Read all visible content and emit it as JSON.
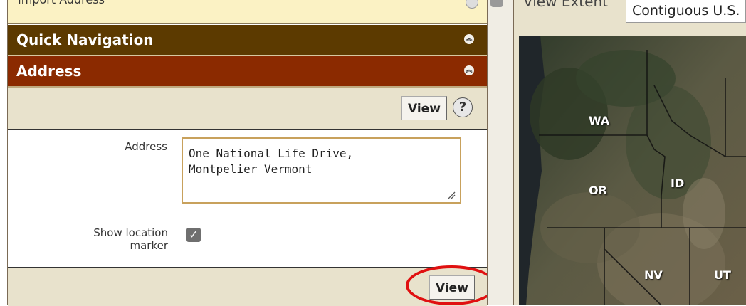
{
  "top_panel": {
    "label": "Import Address"
  },
  "quick_navigation": {
    "title": "Quick Navigation"
  },
  "address_section": {
    "title": "Address",
    "view_label": "View",
    "help_glyph": "?",
    "address_label": "Address",
    "address_value": "One National Life Drive,\nMontpelier Vermont",
    "show_marker_label_line1": "Show location",
    "show_marker_label_line2": "marker",
    "show_marker_checked": true,
    "bottom_view_label": "View"
  },
  "right_pane": {
    "extent_label": "View Extent",
    "extent_value": "Contiguous U.S."
  },
  "map": {
    "labels": [
      "WA",
      "ID",
      "OR",
      "NV",
      "UT"
    ]
  },
  "colors": {
    "quicknav_bar": "#5c3a00",
    "address_bar": "#8b2a00",
    "toolbar": "#e8e2cc",
    "highlight_oval": "#e01010"
  },
  "icons": [
    "collapse-chevron-icon",
    "help-icon",
    "checkbox-check-icon",
    "resize-grip-icon"
  ]
}
